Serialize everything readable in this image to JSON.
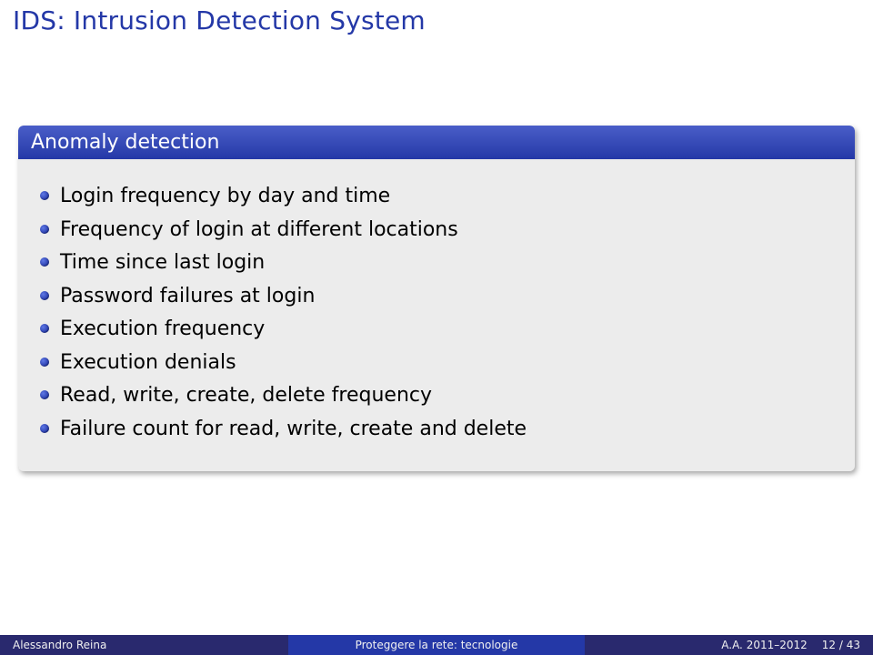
{
  "title": "IDS: Intrusion Detection System",
  "box": {
    "header": "Anomaly detection",
    "items": [
      "Login frequency by day and time",
      "Frequency of login at different locations",
      "Time since last login",
      "Password failures at login",
      "Execution frequency",
      "Execution denials",
      "Read, write, create, delete frequency",
      "Failure count for read, write, create and delete"
    ]
  },
  "footer": {
    "author": "Alessandro Reina",
    "center": "Proteggere la rete: tecnologie",
    "term": "A.A. 2011–2012",
    "page": "12 / 43"
  }
}
